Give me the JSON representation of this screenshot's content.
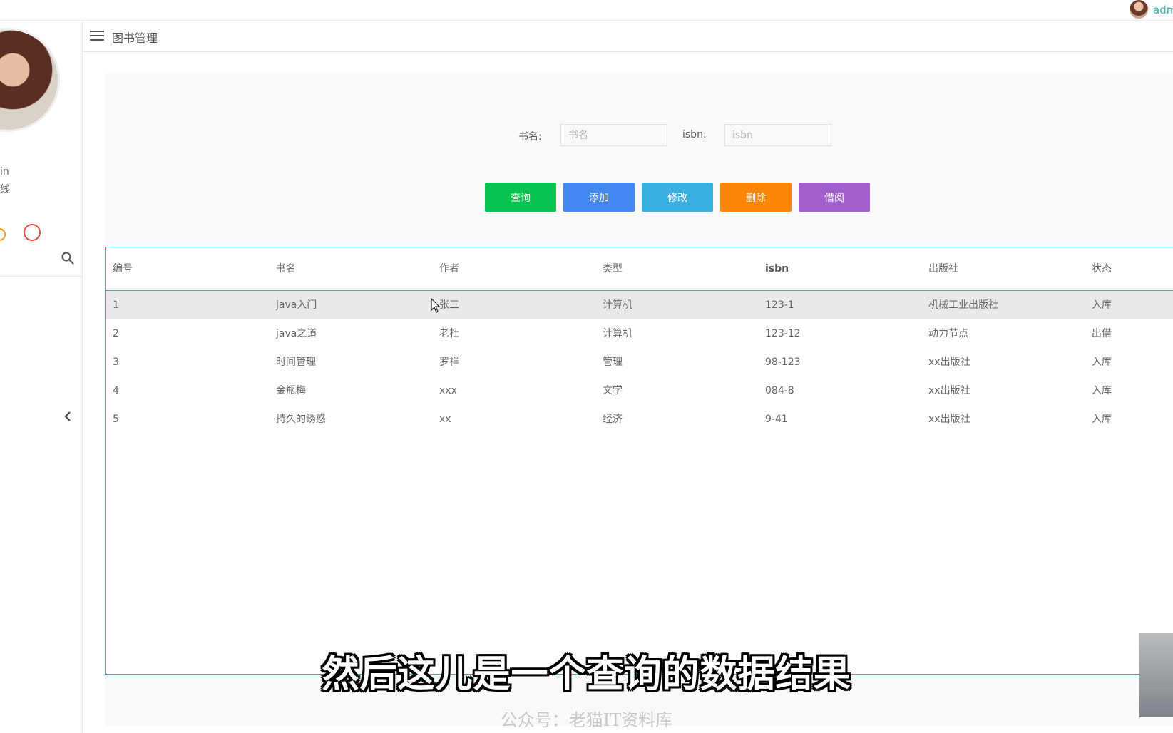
{
  "topbar": {
    "username": "adm"
  },
  "sidebar": {
    "name": "in",
    "status": "线",
    "collapse_icon": "chevron-left-icon"
  },
  "header": {
    "title": "图书管理"
  },
  "form": {
    "bookname_label": "书名:",
    "bookname_placeholder": "书名",
    "isbn_label": "isbn:",
    "isbn_placeholder": "isbn"
  },
  "buttons": [
    {
      "label": "查询",
      "color": "#06c451"
    },
    {
      "label": "添加",
      "color": "#4587f0"
    },
    {
      "label": "修改",
      "color": "#3aafdf"
    },
    {
      "label": "删除",
      "color": "#fb8606"
    },
    {
      "label": "借阅",
      "color": "#a05fcb"
    }
  ],
  "table": {
    "columns": [
      "编号",
      "书名",
      "作者",
      "类型",
      "isbn",
      "出版社",
      "状态"
    ],
    "rows": [
      [
        "1",
        "java入门",
        "张三",
        "计算机",
        "123-1",
        "机械工业出版社",
        "入库"
      ],
      [
        "2",
        "java之道",
        "老杜",
        "计算机",
        "123-12",
        "动力节点",
        "出借"
      ],
      [
        "3",
        "时间管理",
        "罗祥",
        "管理",
        "98-123",
        "xx出版社",
        "入库"
      ],
      [
        "4",
        "金瓶梅",
        "xxx",
        "文学",
        "084-8",
        "xx出版社",
        "入库"
      ],
      [
        "5",
        "持久的诱惑",
        "xx",
        "经济",
        "9-41",
        "xx出版社",
        "入库"
      ]
    ]
  },
  "overlay": {
    "subtitle": "然后这儿是一个查询的数据结果",
    "watermark": "公众号：老猫IT资料库"
  }
}
